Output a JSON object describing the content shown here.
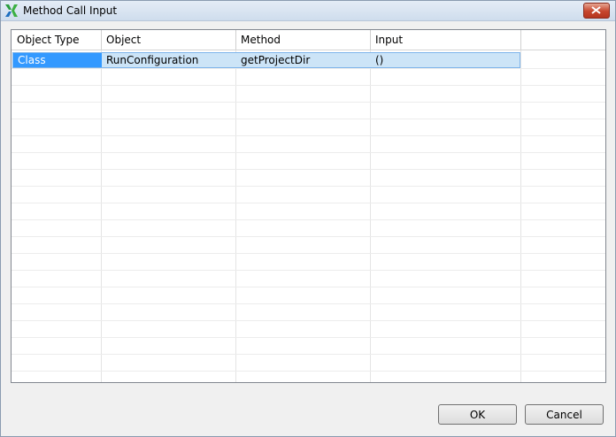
{
  "window": {
    "title": "Method Call Input"
  },
  "table": {
    "columns": [
      "Object Type",
      "Object",
      "Method",
      "Input"
    ],
    "rows": [
      {
        "object_type": "Class",
        "object": "RunConfiguration",
        "method": "getProjectDir",
        "input": "()"
      }
    ]
  },
  "buttons": {
    "ok": "OK",
    "cancel": "Cancel"
  },
  "colors": {
    "selection": "#3399ff",
    "row_highlight": "#cce4f7",
    "close": "#c6452c"
  },
  "icons": {
    "app": "app-logo-icon",
    "close": "close-icon"
  }
}
